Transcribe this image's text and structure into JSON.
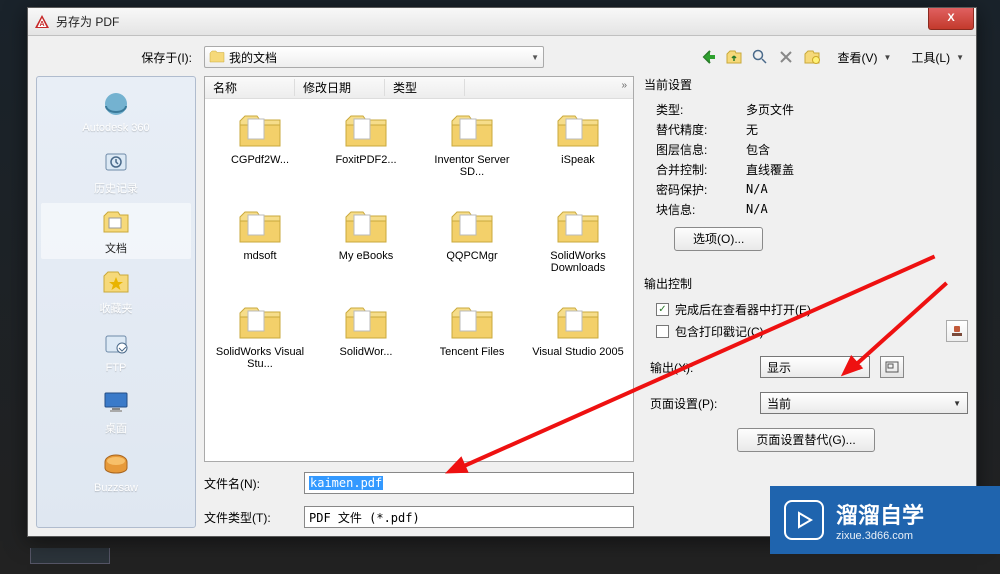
{
  "window": {
    "title": "另存为 PDF",
    "close": "X"
  },
  "saveInLabel": "保存于(I):",
  "saveInValue": "我的文档",
  "places": [
    {
      "label": "Autodesk 360"
    },
    {
      "label": "历史记录"
    },
    {
      "label": "文档"
    },
    {
      "label": "收藏夹"
    },
    {
      "label": "FTP"
    },
    {
      "label": "桌面"
    },
    {
      "label": "Buzzsaw"
    }
  ],
  "browser": {
    "headers": {
      "name": "名称",
      "date": "修改日期",
      "type": "类型"
    },
    "folders": [
      "CGPdf2W...",
      "FoxitPDF2...",
      "Inventor Server SD...",
      "iSpeak",
      "mdsoft",
      "My eBooks",
      "QQPCMgr",
      "SolidWorks Downloads",
      "SolidWorks Visual Stu...",
      "SolidWor...",
      "Tencent Files",
      "Visual Studio 2005"
    ]
  },
  "filenameLabel": "文件名(N):",
  "filenameValue": "kaimen.pdf",
  "filetypeLabel": "文件类型(T):",
  "filetypeValue": "PDF 文件 (*.pdf)",
  "menus": {
    "view": "查看(V)",
    "tools": "工具(L)"
  },
  "currentSettings": {
    "title": "当前设置",
    "rows": {
      "type": {
        "k": "类型:",
        "v": "多页文件"
      },
      "precision": {
        "k": "替代精度:",
        "v": "无"
      },
      "layer": {
        "k": "图层信息:",
        "v": "包含"
      },
      "merge": {
        "k": "合并控制:",
        "v": "直线覆盖"
      },
      "password": {
        "k": "密码保护:",
        "v": "N/A"
      },
      "block": {
        "k": "块信息:",
        "v": "N/A"
      }
    },
    "optionsBtn": "选项(O)..."
  },
  "outputControl": {
    "title": "输出控制",
    "openAfter": "完成后在查看器中打开(E)",
    "stamp": "包含打印戳记(C)",
    "outputLabel": "输出(X):",
    "outputValue": "显示",
    "pageSetupLabel": "页面设置(P):",
    "pageSetupValue": "当前",
    "pageSubBtn": "页面设置替代(G)..."
  },
  "watermark": {
    "big": "溜溜自学",
    "small": "zixue.3d66.com"
  }
}
